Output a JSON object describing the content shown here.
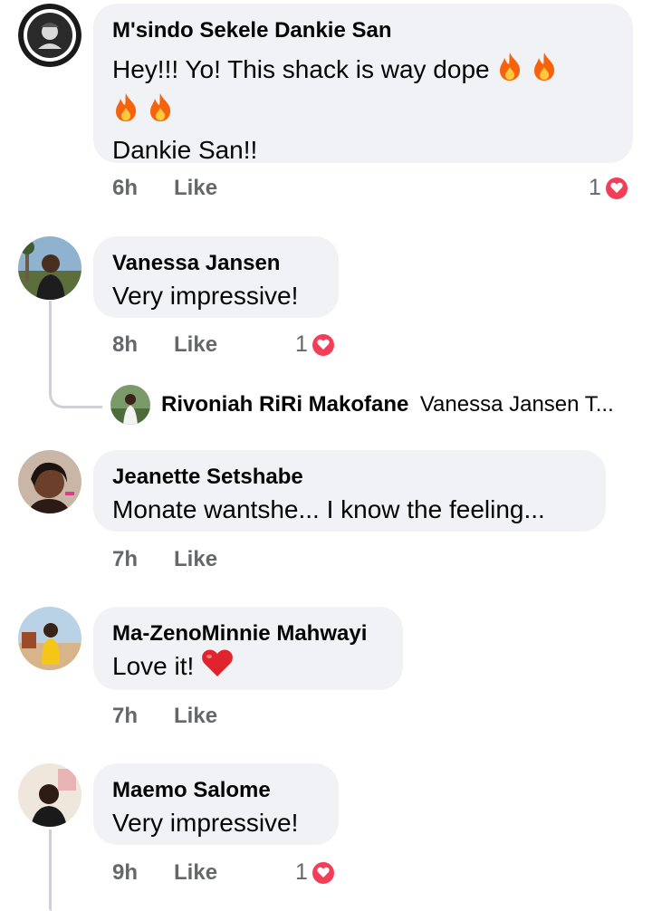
{
  "comments": [
    {
      "author": "M'sindo Sekele Dankie San",
      "line1": "Hey!!! Yo! This shack is way dope",
      "line3": "Dankie San!!",
      "time": "6h",
      "like_label": "Like",
      "reaction_count": "1",
      "emojis": [
        "fire-icon",
        "fire-icon",
        "fire-icon",
        "fire-icon"
      ]
    },
    {
      "author": "Vanessa Jansen",
      "text": "Very impressive!",
      "time": "8h",
      "like_label": "Like",
      "reaction_count": "1"
    },
    {
      "author": "Jeanette Setshabe",
      "text": "Monate wantshe... I know the feeling...",
      "time": "7h",
      "like_label": "Like"
    },
    {
      "author": "Ma-ZenoMinnie Mahwayi",
      "text": "Love it!",
      "time": "7h",
      "like_label": "Like",
      "emojis": [
        "red-heart-icon"
      ]
    },
    {
      "author": "Maemo Salome",
      "text": "Very impressive!",
      "time": "9h",
      "like_label": "Like",
      "reaction_count": "1"
    }
  ],
  "reply_preview": {
    "author": "Rivoniah RiRi Makofane",
    "snippet": "Vanessa Jansen T..."
  },
  "colors": {
    "bubble": "#f0f2f5",
    "meta": "#65676b",
    "love": "#f33e58"
  }
}
